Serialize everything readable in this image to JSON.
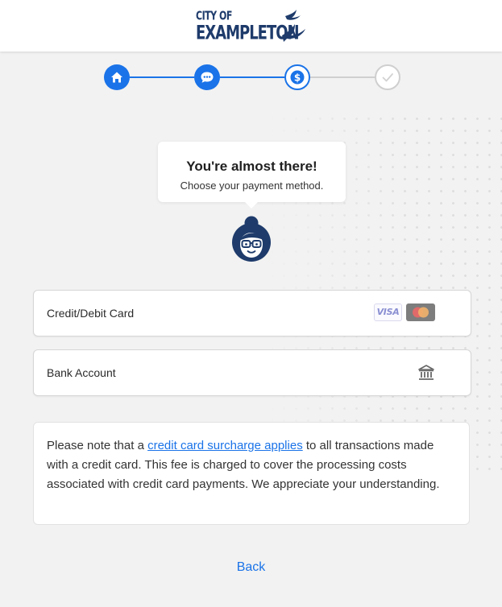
{
  "header": {
    "logo_line1": "CITY OF",
    "logo_line2": "EXAMPLETON"
  },
  "stepper": {
    "steps": [
      {
        "icon": "home-icon",
        "state": "complete"
      },
      {
        "icon": "chat-icon",
        "state": "complete"
      },
      {
        "icon": "dollar-icon",
        "state": "current"
      },
      {
        "icon": "check-icon",
        "state": "upcoming"
      }
    ]
  },
  "bubble": {
    "title": "You're almost there!",
    "subtitle": "Choose your payment method."
  },
  "options": {
    "card_label": "Credit/Debit Card",
    "visa_text": "VISA",
    "bank_label": "Bank Account"
  },
  "note": {
    "text_before": "Please note that a ",
    "link_text": "credit card surcharge applies",
    "text_after": " to all transactions made with a credit card. This fee is charged to cover the processing costs associated with credit card payments. We appreciate your understanding."
  },
  "back_label": "Back",
  "colors": {
    "accent": "#1a73e8",
    "brand_navy": "#1e3b6b",
    "inactive": "#cfcfcf"
  }
}
